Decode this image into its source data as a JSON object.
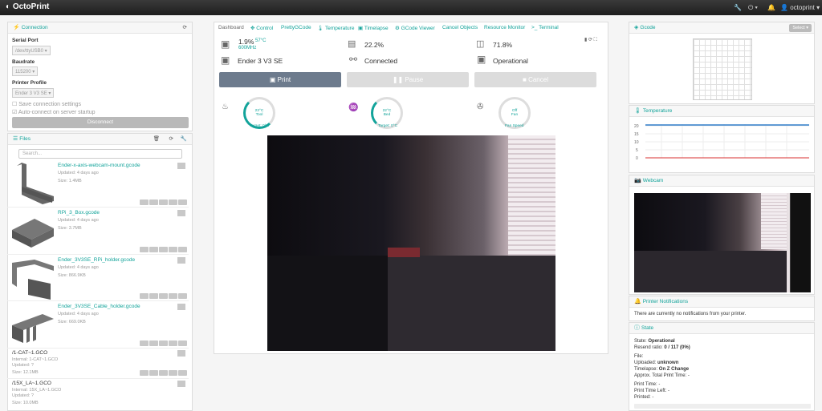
{
  "navbar": {
    "brand": "OctoPrint",
    "user": "octoprint"
  },
  "connection": {
    "title": "Connection",
    "serial_label": "Serial Port",
    "serial_value": "/dev/ttyUSB0",
    "baud_label": "Baudrate",
    "baud_value": "115200",
    "profile_label": "Printer Profile",
    "profile_value": "Ender 3 V3 SE",
    "save_label": "Save connection settings",
    "auto_label": "Auto-connect on server startup",
    "disconnect_label": "Disconnect"
  },
  "files": {
    "title": "Files",
    "search_placeholder": "Search...",
    "items": [
      {
        "name": "Ender-x-axis-webcam-mount.gcode",
        "updated": "Updated: 4 days ago",
        "size": "Size: 1.4MB"
      },
      {
        "name": "RPi_3_Box.gcode",
        "updated": "Updated: 4 days ago",
        "size": "Size: 3.7MB"
      },
      {
        "name": "Ender_3V3SE_RPi_holder.gcode",
        "updated": "Updated: 4 days ago",
        "size": "Size: 866.9KB"
      },
      {
        "name": "Ender_3V3SE_Cable_holder.gcode",
        "updated": "Updated: 4 days ago",
        "size": "Size: 669.0KB"
      },
      {
        "name": "/1-CAT~1.GCO",
        "internal": "Internal: 1-CAT~1.GCO",
        "updated": "Updated: ?",
        "size": "Size: 12.1MB"
      },
      {
        "name": "/15X_LA~1.GCO",
        "internal": "Internal: 15X_LA~1.GCO",
        "updated": "Updated: ?",
        "size": "Size: 10.0MB"
      }
    ]
  },
  "tabs": [
    "Dashboard",
    "Control",
    "PrettyGCode",
    "Temperature",
    "Timelapse",
    "GCode Viewer",
    "Cancel Objects",
    "Resource Monitor",
    "Terminal"
  ],
  "dashboard": {
    "cpu": "1.9%",
    "cpu_temp": "57°C",
    "cpu_freq": "600MHz",
    "mem": "22.2%",
    "disk": "71.8%",
    "printer": "Ender 3 V3 SE",
    "conn": "Connected",
    "state": "Operational",
    "print": "Print",
    "pause": "Pause",
    "cancel": "Cancel",
    "gauges": [
      {
        "value": "23°C",
        "name": "Tool",
        "target": "Target: 0°C"
      },
      {
        "value": "22°C",
        "name": "Bed",
        "target": "Target: 0°C"
      },
      {
        "value": "Off",
        "name": "Fan",
        "target": "Fan Speed"
      }
    ]
  },
  "gcode": {
    "title": "Gcode",
    "select": "Select"
  },
  "temperature": {
    "title": "Temperature",
    "ticks": [
      "20",
      "15",
      "10",
      "5",
      "0"
    ],
    "colors": {
      "tool": "#2e7bc9",
      "bed": "#e05a5a"
    }
  },
  "webcam": {
    "title": "Webcam"
  },
  "notifications": {
    "title": "Printer Notifications",
    "text": "There are currently no notifications from your printer."
  },
  "state": {
    "title": "State",
    "state_label": "State:",
    "state_value": "Operational",
    "resend_label": "Resend ratio:",
    "resend_value": "0 / 117 (0%)",
    "file": "File:",
    "uploaded_label": "Uploaded:",
    "uploaded_value": "unknown",
    "timelapse_label": "Timelapse:",
    "timelapse_value": "On Z Change",
    "approx": "Approx. Total Print Time: -",
    "print_time": "Print Time: -",
    "time_left": "Print Time Left: -",
    "printed": "Printed: -"
  },
  "accent": "#12a39a"
}
